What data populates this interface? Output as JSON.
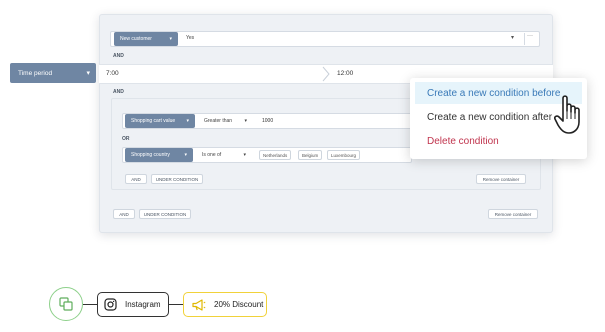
{
  "condition1": {
    "field": "New customer",
    "value": "Yes",
    "more": "···"
  },
  "and_labels": [
    "AND",
    "AND"
  ],
  "time_period": {
    "label": "Time period",
    "from": "7:00",
    "to": "12:00"
  },
  "group1": {
    "field": "Shopping cart value",
    "operator": "Greater than",
    "value": "1000",
    "or_label": "OR",
    "field2": "Shopping country",
    "operator2": "Is one of",
    "tags": [
      "Netherlands",
      "Belgium",
      "Luxembourg"
    ],
    "and_btn": "AND",
    "under_btn": "UNDER CONDITION",
    "remove": "Remove container"
  },
  "footer": {
    "and_btn": "AND",
    "under_btn": "UNDER CONDITION",
    "remove": "Remove container"
  },
  "menu": {
    "items": [
      "Create a new condition before",
      "Create a new condition after",
      "Delete condition"
    ],
    "colors": {
      "highlight_bg": "#e6f4fb",
      "highlight_text": "#3a7ab8",
      "danger": "#c0344d"
    }
  },
  "flow": {
    "node1": "Instagram",
    "node2": "20% Discount"
  },
  "colors": {
    "chip": "#6f86a3",
    "panel": "#eef1f5",
    "flow_green": "#8dd08a",
    "flow_yellow": "#f1d23a"
  }
}
